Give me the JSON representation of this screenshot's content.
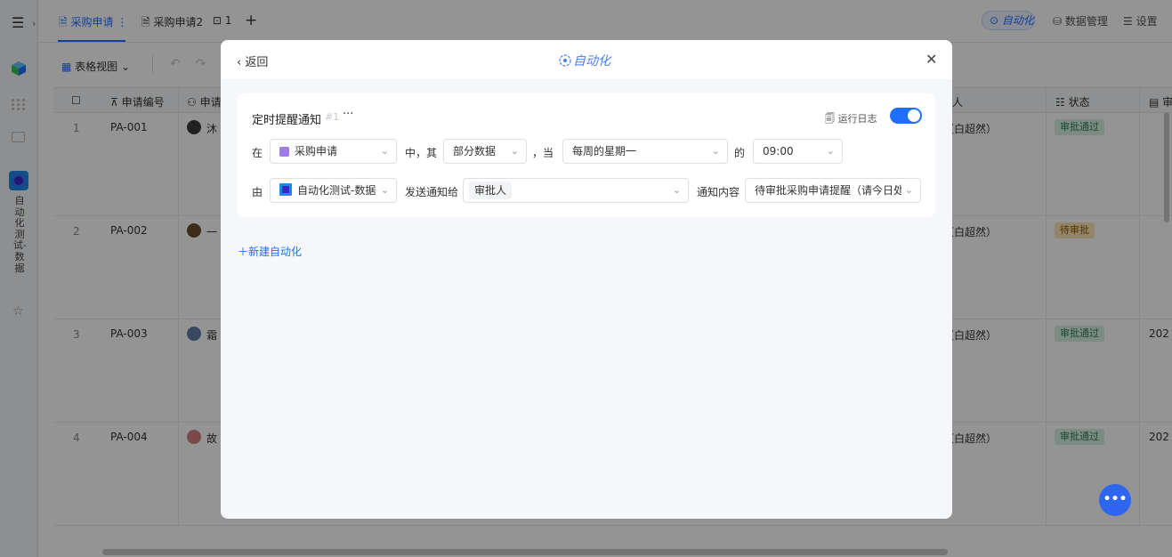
{
  "sidebar": {
    "app_name_vertical": "自动化测试-数据"
  },
  "tabs": [
    {
      "label": "采购申请",
      "active": true
    },
    {
      "label": "采购申请2",
      "active": false
    },
    {
      "label": "1",
      "active": false
    }
  ],
  "header_right": {
    "automation": "自动化",
    "data_manage": "数据管理",
    "settings": "设置"
  },
  "toolbar": {
    "view_label": "表格视图"
  },
  "table": {
    "columns": [
      "申请编号",
      "申请",
      "人",
      "状态",
      "审"
    ],
    "rows": [
      {
        "num": "1",
        "code": "PA-001",
        "name": "沐",
        "approver": "（白超然）",
        "status": "审批通过",
        "status_kind": "ok",
        "date": ""
      },
      {
        "num": "2",
        "code": "PA-002",
        "name": "一",
        "approver": "（白超然）",
        "status": "待审批",
        "status_kind": "wait",
        "date": ""
      },
      {
        "num": "3",
        "code": "PA-003",
        "name": "霜",
        "approver": "（白超然）",
        "status": "审批通过",
        "status_kind": "ok",
        "date": "202"
      },
      {
        "num": "4",
        "code": "PA-004",
        "name": "故",
        "approver": "（白超然）",
        "status": "审批通过",
        "status_kind": "ok",
        "date": "202"
      }
    ]
  },
  "modal": {
    "back_label": "返回",
    "title": "自动化",
    "new_automation": "新建自动化",
    "rule": {
      "name": "定时提醒通知",
      "id": "#1",
      "run_log": "运行日志",
      "enabled": true,
      "row1": {
        "in": "在",
        "table": "采购申请",
        "mid": "中，其",
        "scope": "部分数据",
        "when": "，当",
        "schedule": "每周的星期一",
        "of": "的",
        "time": "09:00"
      },
      "row2": {
        "by": "由",
        "sender": "自动化测试-数据",
        "send_to": "发送通知给",
        "recipient": "审批人",
        "content_label": "通知内容",
        "content": "待审批采购申请提醒（请今日处"
      }
    }
  },
  "fab_label": "•••"
}
